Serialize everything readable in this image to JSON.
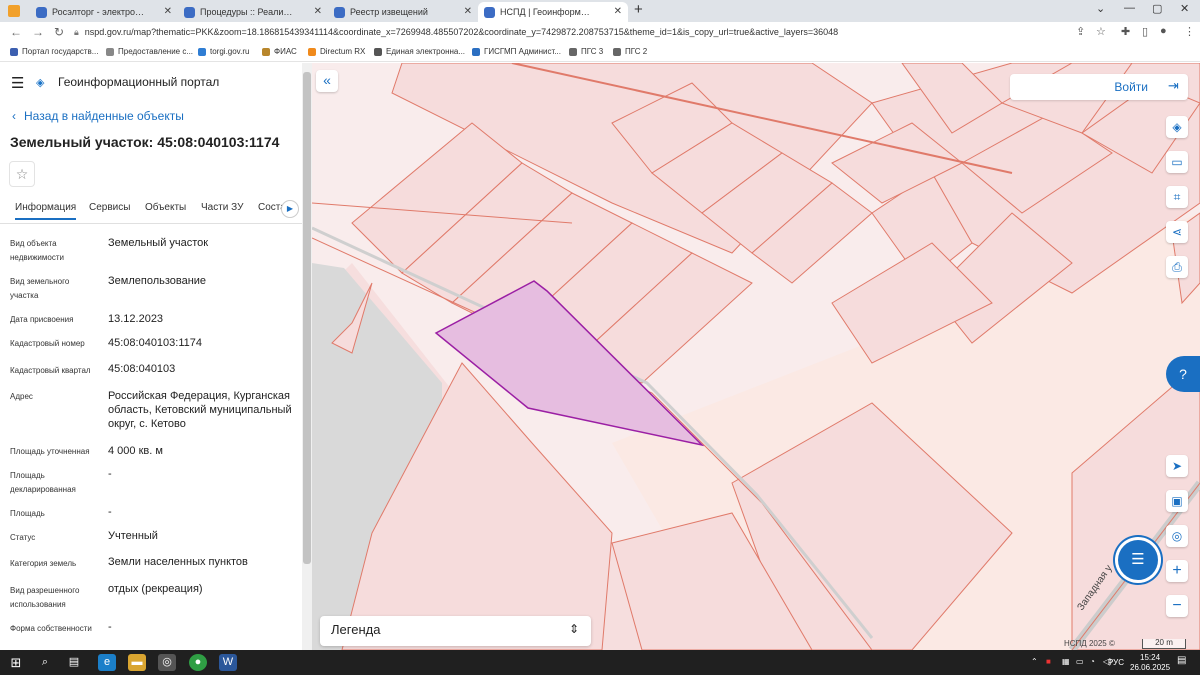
{
  "browser": {
    "tabs": [
      {
        "title": "Росэлторг - электронная торгов"
      },
      {
        "title": "Процедуры :: Реализация госи"
      },
      {
        "title": "Реестр извещений"
      },
      {
        "title": "НСПД | Геоинформационный п"
      }
    ],
    "url": "nspd.gov.ru/map?thematic=PKK&zoom=18.186815439341114&coordinate_x=7269948.485507202&coordinate_y=7429872.208753715&theme_id=1&is_copy_url=true&active_layers=36048",
    "bookmarks": [
      "Портал государств...",
      "Предоставление с...",
      "torgi.gov.ru",
      "ФИАС",
      "Directum RX",
      "Единая электронна...",
      "ГИСГМП Админист...",
      "ПГС 3",
      "ПГС 2"
    ],
    "colors": {
      "tabbar": "#dfe3e8",
      "accent": "#1a6fc2",
      "parcel_fill": "#e8b8e0",
      "parcel_stroke": "#9b1fa4",
      "parcel_lines": "#e07a6a"
    }
  },
  "portal": {
    "title": "Геоинформационный портал",
    "back_label": "Назад в найденные объекты",
    "object_title": "Земельный участок: 45:08:040103:1174",
    "tabs": [
      "Информация",
      "Сервисы",
      "Объекты",
      "Части ЗУ",
      "Соста"
    ],
    "fields": [
      {
        "label": "Вид объекта недвижимости",
        "value": "Земельный участок"
      },
      {
        "label": "Вид земельного участка",
        "value": "Землепользование"
      },
      {
        "label": "Дата присвоения",
        "value": "13.12.2023"
      },
      {
        "label": "Кадастровый номер",
        "value": "45:08:040103:1174"
      },
      {
        "label": "Кадастровый квартал",
        "value": "45:08:040103"
      },
      {
        "label": "Адрес",
        "value": "Российская Федерация, Курганская область, Кетовский муниципальный округ, с. Кетово"
      },
      {
        "label": "Площадь уточненная",
        "value": "4 000 кв. м"
      },
      {
        "label": "Площадь декларированная",
        "value": "-"
      },
      {
        "label": "Площадь",
        "value": "-"
      },
      {
        "label": "Статус",
        "value": "Учтенный"
      },
      {
        "label": "Категория земель",
        "value": "Земли населенных пунктов"
      },
      {
        "label": "Вид разрешенного использования",
        "value": "отдых (рекреация)"
      },
      {
        "label": "Форма собственности",
        "value": "-"
      }
    ]
  },
  "map": {
    "login_label": "Войти",
    "legend_label": "Легенда",
    "copyright": "НСПД 2025 ©",
    "scale_label": "20 m",
    "street_label": "Западная у",
    "buttons": [
      "layers-icon",
      "ruler-icon",
      "qr-search-icon",
      "share-icon",
      "print-icon",
      "navigate-icon",
      "minimap-icon",
      "locate-icon",
      "zoom-in-icon",
      "zoom-out-icon"
    ]
  },
  "taskbar": {
    "lang": "РУС",
    "time": "15:24",
    "date": "26.06.2025"
  }
}
